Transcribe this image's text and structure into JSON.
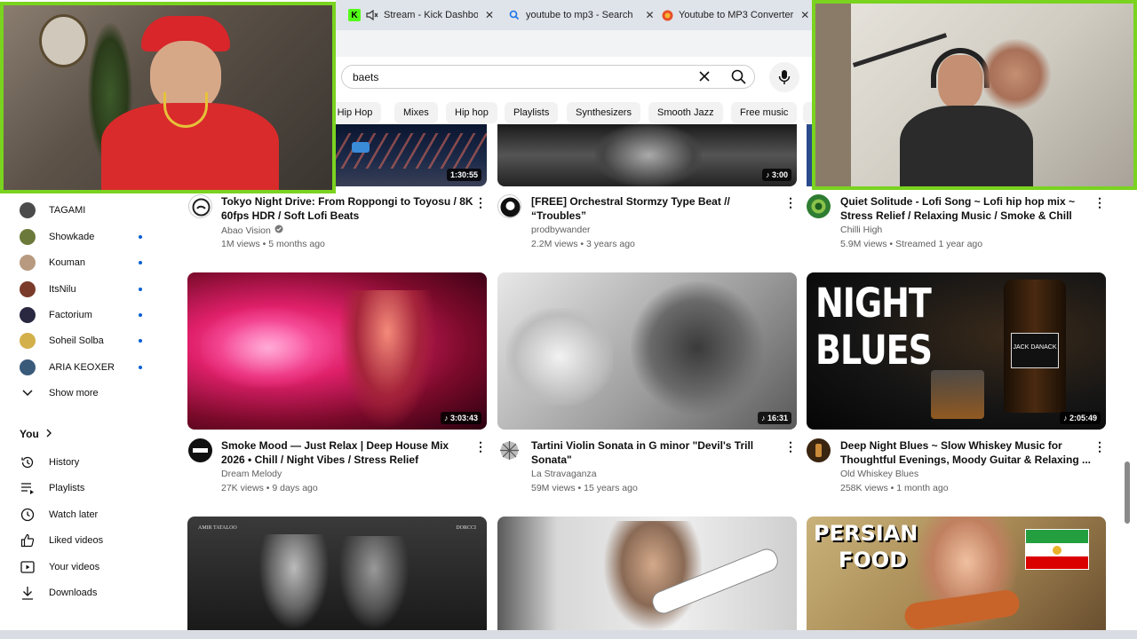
{
  "browser": {
    "tabs": [
      {
        "title": "Stream - Kick Dashboa",
        "close": "✕"
      },
      {
        "title": "youtube to mp3 - Search",
        "close": "✕"
      },
      {
        "title": "Youtube to MP3 Converter",
        "close": "✕"
      }
    ]
  },
  "search": {
    "value": "baets",
    "clear_icon": "x-icon",
    "search_icon": "search-icon",
    "mic_icon": "mic-icon"
  },
  "chips": [
    "al Hip Hop",
    "Mixes",
    "Hip hop",
    "Playlists",
    "Synthesizers",
    "Smooth Jazz",
    "Free music"
  ],
  "sidebar": {
    "subscriptions": [
      {
        "name": "TAGAMI",
        "new": false
      },
      {
        "name": "Showkade",
        "new": true
      },
      {
        "name": "Kouman",
        "new": true
      },
      {
        "name": "ItsNilu",
        "new": true
      },
      {
        "name": "Factorium",
        "new": true
      },
      {
        "name": "Soheil Solba",
        "new": true
      },
      {
        "name": "ARIA KEOXER",
        "new": true
      }
    ],
    "show_more": "Show more",
    "you_label": "You",
    "you_items": [
      {
        "label": "History",
        "icon": "history-icon"
      },
      {
        "label": "Playlists",
        "icon": "playlists-icon"
      },
      {
        "label": "Watch later",
        "icon": "watch-later-icon"
      },
      {
        "label": "Liked videos",
        "icon": "like-icon"
      },
      {
        "label": "Your videos",
        "icon": "your-videos-icon"
      },
      {
        "label": "Downloads",
        "icon": "download-icon"
      }
    ]
  },
  "videos_row1": [
    {
      "duration": "1:30:55",
      "title": "Tokyo Night Drive: From Roppongi to Toyosu / 8K 60fps HDR / Soft Lofi Beats",
      "channel": "Abao Vision",
      "verified": true,
      "meta": "1M views • 5 months ago"
    },
    {
      "duration": "3:00",
      "title": "[FREE] Orchestral Stormzy Type Beat // “Troubles”",
      "channel": "prodbywander",
      "verified": false,
      "meta": "2.2M views • 3 years ago"
    },
    {
      "duration": "",
      "title": "Quiet Solitude - Lofi Song ~ Lofi hip hop mix ~ Stress Relief / Relaxing Music / Smoke & Chill",
      "channel": "Chilli High",
      "verified": false,
      "meta": "5.9M views • Streamed 1 year ago"
    }
  ],
  "videos_row2": [
    {
      "duration": "3:03:43",
      "title": "Smoke Mood — Just Relax | Deep House Mix 2026 • Chill / Night Vibes / Stress Relief",
      "channel": "Dream Melody",
      "meta": "27K views • 9 days ago"
    },
    {
      "duration": "16:31",
      "title": "Tartini Violin Sonata in G minor \"Devil's Trill Sonata\"",
      "channel": "La Stravaganza",
      "meta": "59M views • 15 years ago"
    },
    {
      "duration": "2:05:49",
      "title": "Deep Night Blues ~ Slow Whiskey Music for Thoughtful Evenings, Moody Guitar & Relaxing ...",
      "channel": "Old Whiskey Blues",
      "meta": "258K views • 1 month ago"
    }
  ],
  "thumb_text": {
    "night_blues_line1": "NIGHT",
    "night_blues_line2": "BLUES",
    "persian_line1": "PERSIAN",
    "persian_line2": "FOOD",
    "tataloo_left": "AMIR TATALOO",
    "tataloo_right": "DORCCI",
    "whiskey_label": "JACK DANACK"
  },
  "colors": {
    "accent": "#065fd4",
    "cam_border": "#7ad31f",
    "chip_bg": "#f2f2f2"
  }
}
